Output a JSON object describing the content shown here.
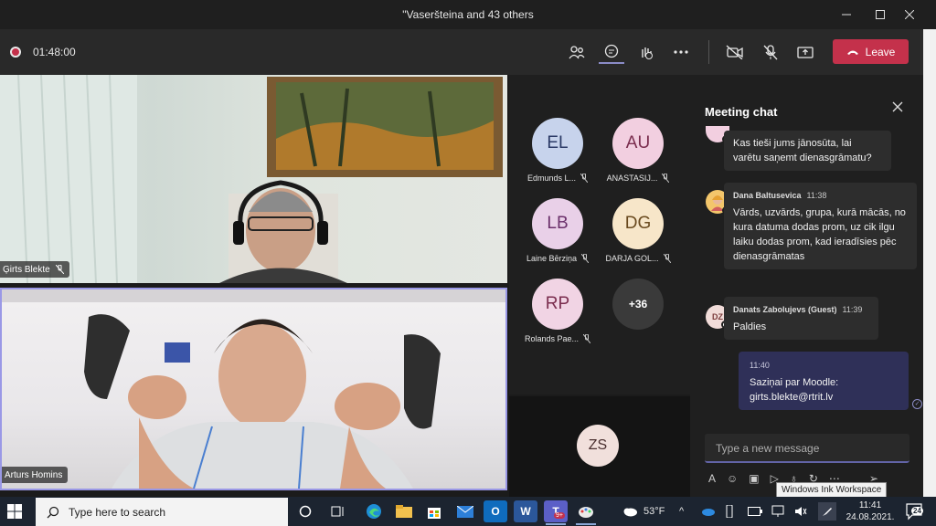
{
  "window": {
    "title": "\"Vaseršteina and 43 others"
  },
  "toolbar": {
    "timer": "01:48:00",
    "leave_label": "Leave"
  },
  "videos": [
    {
      "name": "Ģirts Blekte"
    },
    {
      "name": "Arturs Homins"
    }
  ],
  "roster": {
    "participants": [
      {
        "initials": "EL",
        "name": "Edmunds L...",
        "color": "#c7d3ec"
      },
      {
        "initials": "AU",
        "name": "ANASTASIJ...",
        "color": "#f2cfe0"
      },
      {
        "initials": "LB",
        "name": "Laine Bērziņa",
        "color": "#e9d0e8"
      },
      {
        "initials": "DG",
        "name": "DARJA GOL...",
        "color": "#f7e6c9"
      },
      {
        "initials": "RP",
        "name": "Rolands Pae...",
        "color": "#f1d4e4"
      }
    ],
    "overflow_label": "+36",
    "extra_tile": {
      "initials": "ZS",
      "color": "#f1e0dc"
    }
  },
  "chat": {
    "title": "Meeting chat",
    "messages": [
      {
        "text": "Kas tieši jums jānosūta, lai varētu saņemt dienasgrāmatu?"
      },
      {
        "author": "Dana Baltusevica",
        "time": "11:38",
        "text": "Vārds, uzvārds, grupa, kurā mācās, no kura datuma dodas prom, uz cik ilgu laiku dodas prom, kad ieradīsies pēc dienasgrāmatas"
      },
      {
        "author": "Danats Zabolujevs (Guest)",
        "initials": "DZ",
        "time": "11:39",
        "text": "Paldies"
      }
    ],
    "own_message": {
      "time": "11:40",
      "line1": "Saziņai par Moodle:",
      "line2": "girts.blekte@rtrit.lv"
    },
    "compose_placeholder": "Type a new message",
    "tooltip": "Windows Ink Workspace"
  },
  "taskbar": {
    "search_placeholder": "Type here to search",
    "weather": "53°F",
    "time": "11:41",
    "date": "24.08.2021.",
    "notification_count": "24",
    "teams_badge": "9+"
  },
  "colors": {
    "accent": "#6264a7",
    "leave": "#c4314b",
    "busy": "#c4314b",
    "away": "#ffffff"
  }
}
